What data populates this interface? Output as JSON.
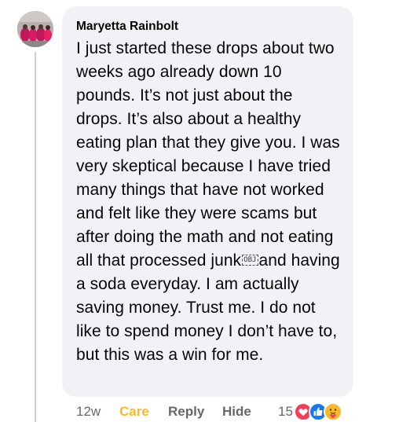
{
  "comment": {
    "author": "Maryetta Rainbolt",
    "text_before_obj": "I just started these drops about two weeks ago already down 10 pounds. It’s not just about the drops. It’s also about a healthy eating plan that they give you. I was very skeptical because I have tried many things that have not worked and felt like they were scams but after doing the math and not eating all that processed junk",
    "obj_glyph": "OBJ",
    "text_after_obj": "and having a soda everyday. I am actually saving money. Trust me. I do not like to spend money I don’t have to, but this was a win for me."
  },
  "actions": {
    "time": "12w",
    "care": "Care",
    "reply": "Reply",
    "hide": "Hide",
    "reaction_count": "15",
    "reactions": [
      "love-icon",
      "like-icon",
      "care-icon"
    ]
  },
  "colors": {
    "bubble": "#f0f2f5",
    "care": "#f7b928",
    "meta": "#65676b",
    "love": "#f33e58",
    "like": "#1877f2",
    "care_face": "#f7b928"
  }
}
